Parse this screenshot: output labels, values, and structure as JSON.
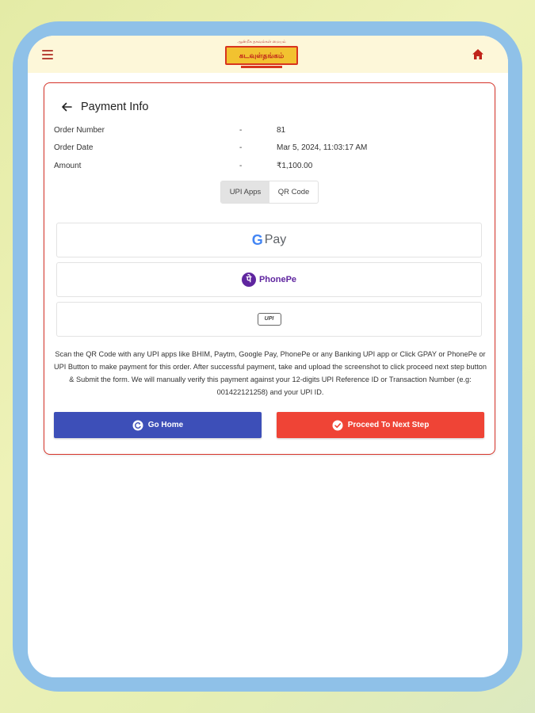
{
  "header": {
    "logo_tagline": "ஆன்மீக தகவல்கள் மையம்",
    "logo_text": "கடவுள்தங்கம்"
  },
  "payment": {
    "title": "Payment Info",
    "rows": [
      {
        "label": "Order Number",
        "sep": "-",
        "value": "81"
      },
      {
        "label": "Order Date",
        "sep": "-",
        "value": "Mar 5, 2024, 11:03:17 AM"
      },
      {
        "label": "Amount",
        "sep": "-",
        "value": "₹1,100.00"
      }
    ],
    "tabs": [
      {
        "label": "UPI Apps",
        "active": true
      },
      {
        "label": "QR Code",
        "active": false
      }
    ],
    "apps": {
      "gpay_g": "G",
      "gpay_label": "Pay",
      "phonepe_mark": "पे",
      "phonepe_label": "PhonePe",
      "upi_label": "UPI"
    },
    "instructions": "Scan the QR Code with any UPI apps like BHIM, Paytm, Google Pay, PhonePe or any Banking UPI app or Click GPAY or PhonePe or UPI Button to make payment for this order. After successful payment, take and upload the screenshot to click proceed next step button & Submit the form. We will manually verify this payment against your 12-digits UPI Reference ID or Transaction Number (e.g: 001422121258) and your UPI ID.",
    "buttons": {
      "go_home": "Go Home",
      "proceed": "Proceed To Next Step"
    }
  },
  "colors": {
    "accent_red": "#ef4436",
    "accent_blue": "#3d4fb8",
    "device_frame": "#8fc1e8",
    "appbar_bg": "#fdf7d9"
  }
}
